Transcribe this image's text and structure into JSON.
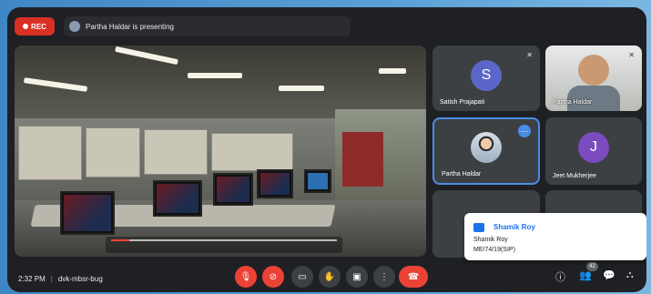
{
  "topbar": {
    "rec_label": "REC",
    "presenting_text": "Partha Haldar is presenting"
  },
  "participants": [
    {
      "name": "Satish Prajapati",
      "initial": "S",
      "color": "#5b67c8"
    },
    {
      "name": "Partha Haldar",
      "initial": "",
      "color": "#3c4043"
    },
    {
      "name": "Partha Haldar",
      "initial": "",
      "color": "#3c4043"
    },
    {
      "name": "Jeet Mukherjee",
      "initial": "J",
      "color": "#7b4bc0"
    }
  ],
  "toast": {
    "title": "Shamik Roy",
    "line1": "Shamik Roy",
    "line2": "ME/74/19(SIP)"
  },
  "bottombar": {
    "time": "2:32 PM",
    "separator": "|",
    "meeting_code": "dvk-mbsr-bug",
    "participant_count": "42"
  },
  "video": {
    "progress": 0.08
  },
  "colors": {
    "accent": "#1a73e8",
    "danger": "#ea4335",
    "background": "#1f2024"
  }
}
